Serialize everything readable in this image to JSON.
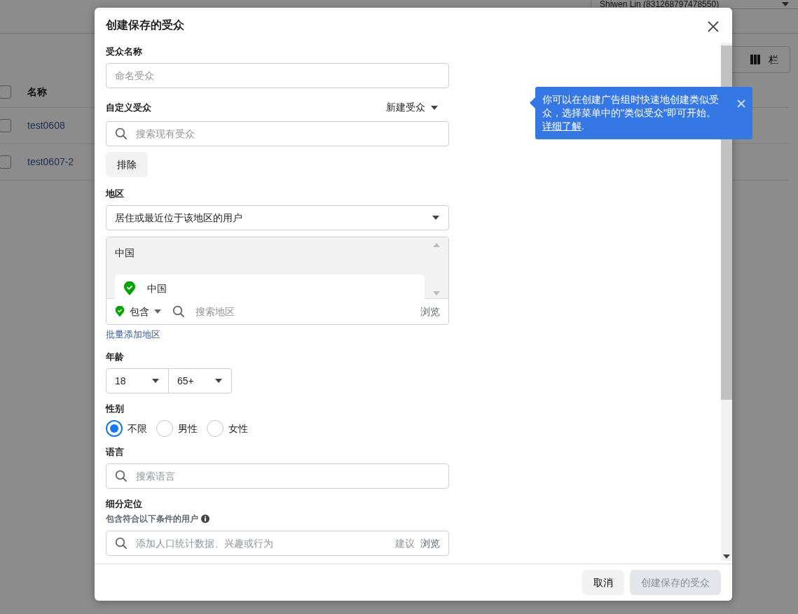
{
  "background_page": {
    "account": "Shiwen Lin (831268797478550)",
    "columns_button": "栏",
    "table": {
      "all_checked": false,
      "columns": [
        "名称"
      ],
      "rows": [
        {
          "name": "test0608",
          "checked": false
        },
        {
          "name": "test0607-2",
          "checked": false
        }
      ]
    }
  },
  "dialog": {
    "title": "创建保存的受众",
    "audience_name": {
      "label": "受众名称",
      "placeholder": "命名受众"
    },
    "custom_audience": {
      "label": "自定义受众",
      "create_new": "新建受众",
      "placeholder": "搜索现有受众",
      "exclude_button": "排除"
    },
    "location": {
      "label": "地区",
      "select_value": "居住或最近位于该地区的用户",
      "group": "中国",
      "items": [
        {
          "name": "中国"
        }
      ],
      "mode": "包含",
      "placeholder": "搜索地区",
      "browse": "浏览",
      "bulk_link": "批量添加地区"
    },
    "age": {
      "label": "年龄",
      "min": "18",
      "max": "65+"
    },
    "gender": {
      "label": "性别",
      "options": [
        {
          "label": "不限",
          "selected": true
        },
        {
          "label": "男性",
          "selected": false
        },
        {
          "label": "女性",
          "selected": false
        }
      ]
    },
    "language": {
      "label": "语言",
      "placeholder": "搜索语言"
    },
    "detailed_targeting": {
      "label": "细分定位",
      "sublabel": "包含符合以下条件的用户",
      "placeholder": "添加人口统计数据、兴趣或行为",
      "suggest": "建议",
      "browse": "浏览"
    },
    "buttons": [
      {
        "label": "取消",
        "kind": "secondary",
        "disabled": false
      },
      {
        "label": "创建保存的受众",
        "kind": "primary",
        "disabled": true
      }
    ]
  },
  "tooltip": {
    "text": "你可以在创建广告组时快速地创建类似受众，选择菜单中的\"类似受众\"即可开始。 ",
    "link": "详细了解",
    "suffix": "."
  }
}
